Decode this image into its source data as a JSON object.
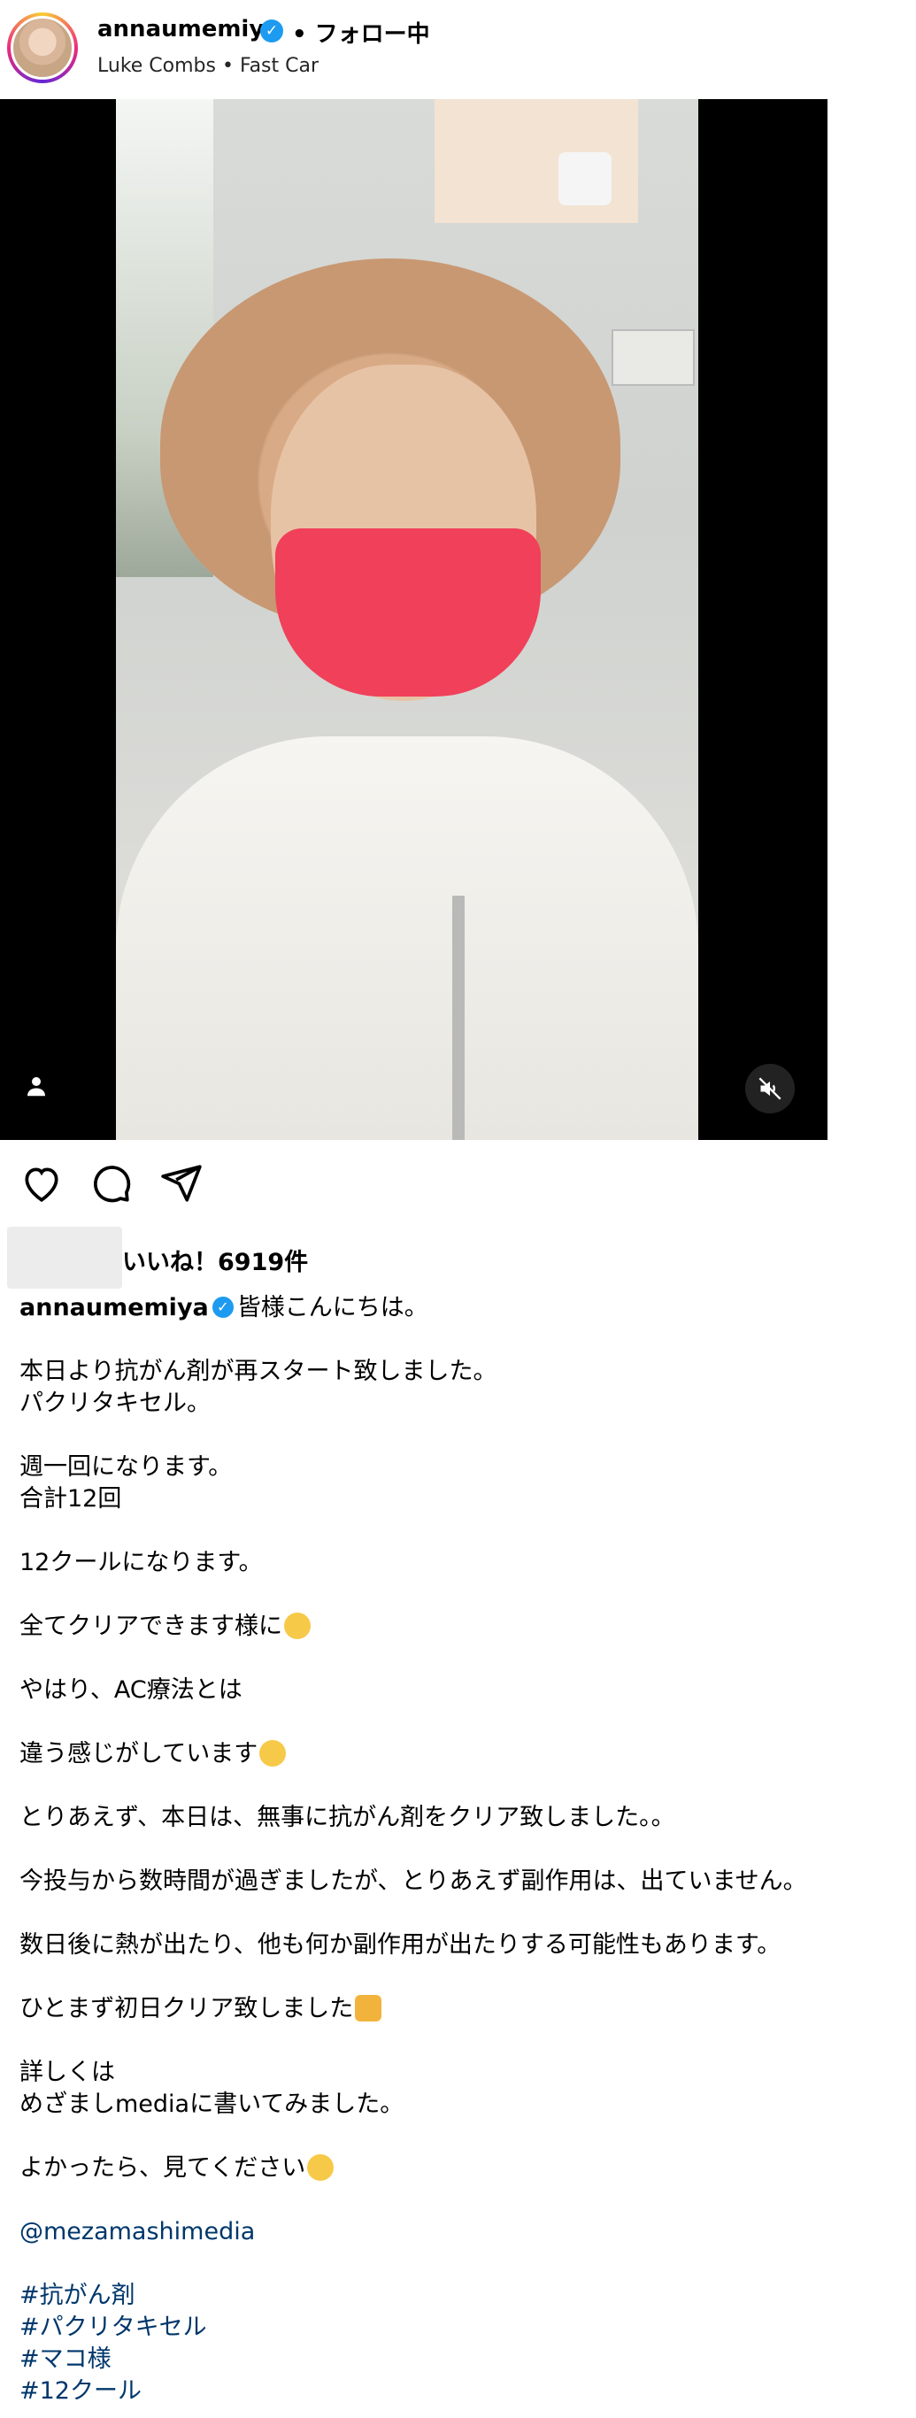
{
  "header": {
    "username": "annaumemiya",
    "verified_mark": "✓",
    "follow_status": "• フォロー中",
    "music": "Luke Combs • Fast Car"
  },
  "media": {
    "type": "video",
    "muted": true,
    "icons": [
      "person-icon",
      "mute-icon"
    ]
  },
  "actions": [
    "heart-icon",
    "comment-icon",
    "share-icon"
  ],
  "likes_text": "いいね！6919件",
  "caption": {
    "username": "annaumemiya",
    "first_line": "皆様こんにちは。",
    "lines": [
      "",
      "本日より抗がん剤が再スタート致しました。",
      "パクリタキセル。",
      "",
      "週一回になります。",
      "合計12回",
      "",
      "12クールになります。",
      "",
      "全てクリアできます様に",
      "",
      "やはり、AC療法とは",
      "",
      "違う感じがしています",
      "",
      "とりあえず、本日は、無事に抗がん剤をクリア致しました。。",
      "",
      "今投与から数時間が過ぎましたが、とりあえず副作用は、出ていません。",
      "",
      "数日後に熱が出たり、他も何か副作用が出たりする可能性もあります。",
      "",
      "ひとまず初日クリア致しました",
      "",
      "詳しくは",
      "めざましmediaに書いてみました。",
      "",
      "よかったら、見てください"
    ],
    "mention": "@mezamashimedia",
    "hashtags": [
      "#抗がん剤",
      "#パクリタキセル",
      "#マコ様",
      "#12クール"
    ]
  },
  "colors": {
    "link": "#00376b",
    "verified": "#1d9bf0"
  }
}
